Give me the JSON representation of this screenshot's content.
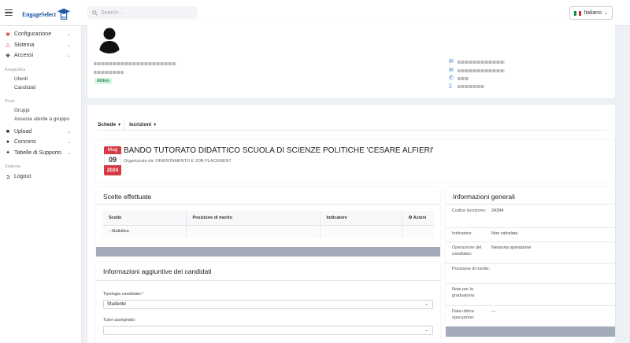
{
  "header": {
    "brand": "EngageSelect",
    "brand_suffix": "bn",
    "search_placeholder": "Search...",
    "language": "Italiano",
    "flag_colors": [
      "#009246",
      "#ffffff",
      "#ce2b37"
    ]
  },
  "sidebar": {
    "items_top": [
      {
        "label": "Configurazione",
        "icon": "wrench-icon",
        "expandable": true
      },
      {
        "label": "Sistema",
        "icon": "sitemap-icon",
        "expandable": true
      },
      {
        "label": "Accessi",
        "icon": "info-circle-icon",
        "expandable": true
      }
    ],
    "section_anagrafica": "Anagrafica",
    "anagrafica_items": [
      "Utenti",
      "Candidati"
    ],
    "section_ruoli": "Ruoli",
    "ruoli_items": [
      "Gruppi",
      "Associa utente a gruppo"
    ],
    "items_mid": [
      {
        "label": "Upload",
        "icon": "user-upload-icon"
      },
      {
        "label": "Concorsi",
        "icon": "users-icon"
      },
      {
        "label": "Tabelle di Supporto",
        "icon": "cogs-icon"
      }
    ],
    "section_sistema": "Sistema",
    "logout": "Logout"
  },
  "profile": {
    "status": "Attivo"
  },
  "tabs": [
    {
      "label": "Schede"
    },
    {
      "label": "Iscrizioni"
    }
  ],
  "course": {
    "month": "Mag",
    "day": "09",
    "year": "2024",
    "title": "BANDO TUTORATO DIDATTICO SCUOLA DI SCIENZE POLITICHE 'CESARE ALFIERI'",
    "organizer": "Organizzato da: ORIENTAMENTO E JOB PLACEMENT"
  },
  "scelte": {
    "title": "Scelte effettuate",
    "columns": [
      "Scelte",
      "Posizione di merito",
      "Indicatore",
      "Azioni"
    ],
    "rows": [
      [
        "- Statistica",
        "",
        "",
        ""
      ]
    ]
  },
  "info_aggiuntive": {
    "title": "Informazioni aggiuntive dei candidati",
    "tipologia_label": "Tipologia candidato:",
    "tipologia_required": "*",
    "tipologia_value": "Studente",
    "tutor_label": "Tutor assegnato:",
    "tutor_value": ""
  },
  "info_generali": {
    "title": "Informazioni generali",
    "rows": [
      {
        "label": "Codice iscrizione:",
        "value": "24394"
      },
      {
        "label": "Indicatore:",
        "value": "Non calcolata"
      },
      {
        "label": "Operazione del candidato:",
        "value": "Nessuna operazione"
      },
      {
        "label": "Posizione di merito:",
        "value": ""
      },
      {
        "label": "Note per la graduatoria:",
        "value": ""
      },
      {
        "label": "Data ultima operazione:",
        "value": "---"
      }
    ]
  }
}
